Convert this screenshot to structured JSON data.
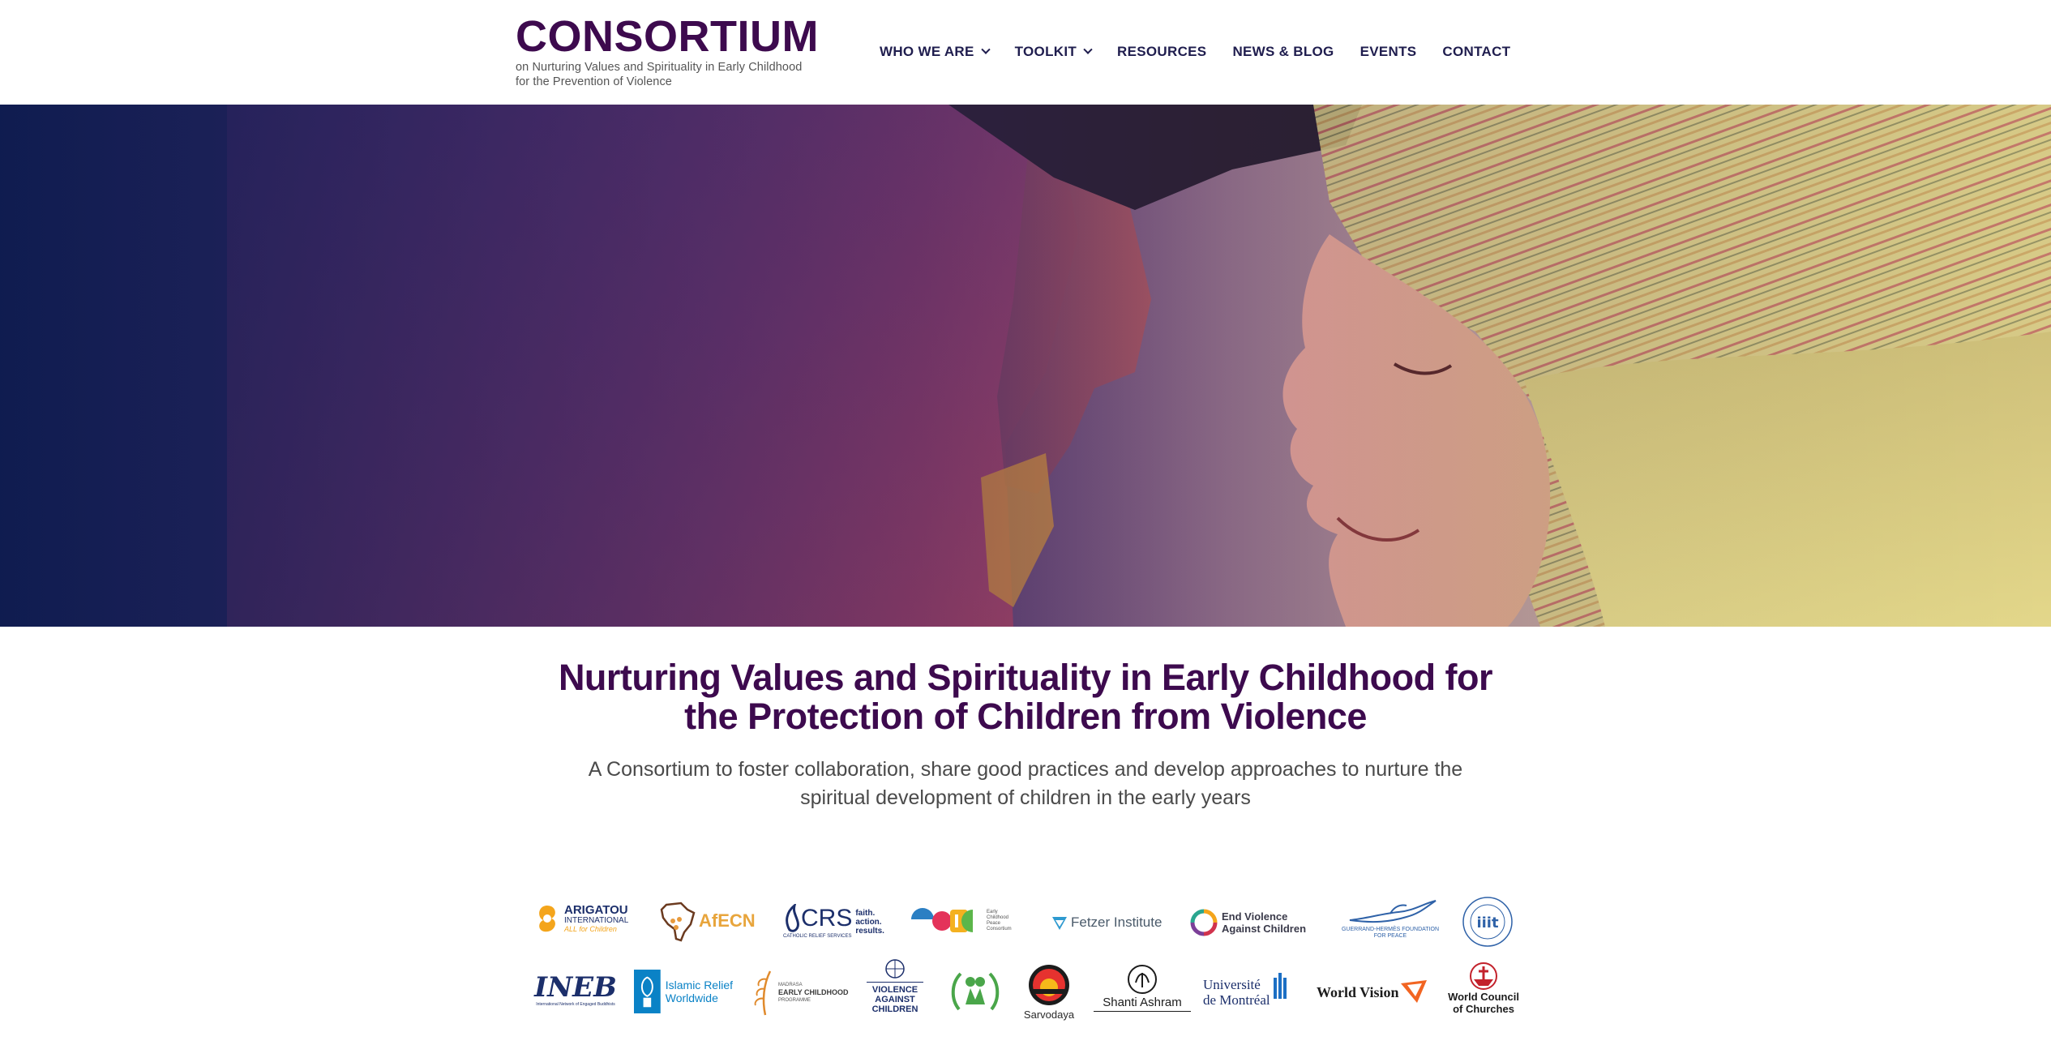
{
  "header": {
    "logo_title": "CONSORTIUM",
    "logo_subtitle_line1": "on Nurturing Values and Spirituality in Early Childhood",
    "logo_subtitle_line2": "for the Prevention of Violence"
  },
  "nav": {
    "items": [
      {
        "label": "WHO WE ARE",
        "dropdown": true
      },
      {
        "label": "TOOLKIT",
        "dropdown": true
      },
      {
        "label": "RESOURCES",
        "dropdown": false
      },
      {
        "label": "NEWS & BLOG",
        "dropdown": false
      },
      {
        "label": "EVENTS",
        "dropdown": false
      },
      {
        "label": "CONTACT",
        "dropdown": false
      }
    ]
  },
  "intro": {
    "heading_line1": "Nurturing Values and Spirituality in Early Childhood for",
    "heading_line2": "the Protection of Children from Violence",
    "description_line1": "A Consortium to foster collaboration, share good practices and develop approaches to nurture the",
    "description_line2": "spiritual development of children in the early years"
  },
  "partners": {
    "arigatou": {
      "line1": "ARIGATOU",
      "line2": "INTERNATIONAL",
      "line3": "ALL for Children"
    },
    "afecn": {
      "name": "AfECN"
    },
    "crs": {
      "name": "CRS",
      "sub": "CATHOLIC RELIEF SERVICES",
      "tag1": "faith.",
      "tag2": "action.",
      "tag3": "results."
    },
    "ecpc": {
      "line1": "Early",
      "line2": "Childhood",
      "line3": "Peace",
      "line4": "Consortium"
    },
    "fetzer": {
      "name": "Fetzer Institute"
    },
    "end_violence": {
      "line1": "End Violence",
      "line2": "Against Children"
    },
    "guerrand": {
      "line1": "GUERRAND-HERMÈS FOUNDATION",
      "line2": "FOR PEACE"
    },
    "iiit": {
      "name": "iiit",
      "ring": "INTERNATIONAL INSTITUTE OF ISLAMIC THOUGHT"
    },
    "ineb": {
      "name": "INEB",
      "sub": "International Network of Engaged Buddhists"
    },
    "islamic_relief": {
      "line1": "Islamic Relief",
      "line2": "Worldwide"
    },
    "madrasa": {
      "line1": "MADRASA",
      "line2": "EARLY CHILDHOOD",
      "line3": "PROGRAMME"
    },
    "vac": {
      "line1": "VIOLENCE",
      "line2": "AGAINST",
      "line3": "CHILDREN"
    },
    "sarvodaya": {
      "name": "Sarvodaya"
    },
    "shanti": {
      "name": "Shanti Ashram"
    },
    "montreal": {
      "line1": "Université",
      "line2": "de Montréal"
    },
    "world_vision": {
      "name": "World Vision"
    },
    "wcc": {
      "line1": "World Council",
      "line2": "of Churches"
    }
  },
  "colors": {
    "brand_purple": "#3d0a4e",
    "nav_text": "#1f1d4e",
    "body_text": "#4a4a4a"
  }
}
